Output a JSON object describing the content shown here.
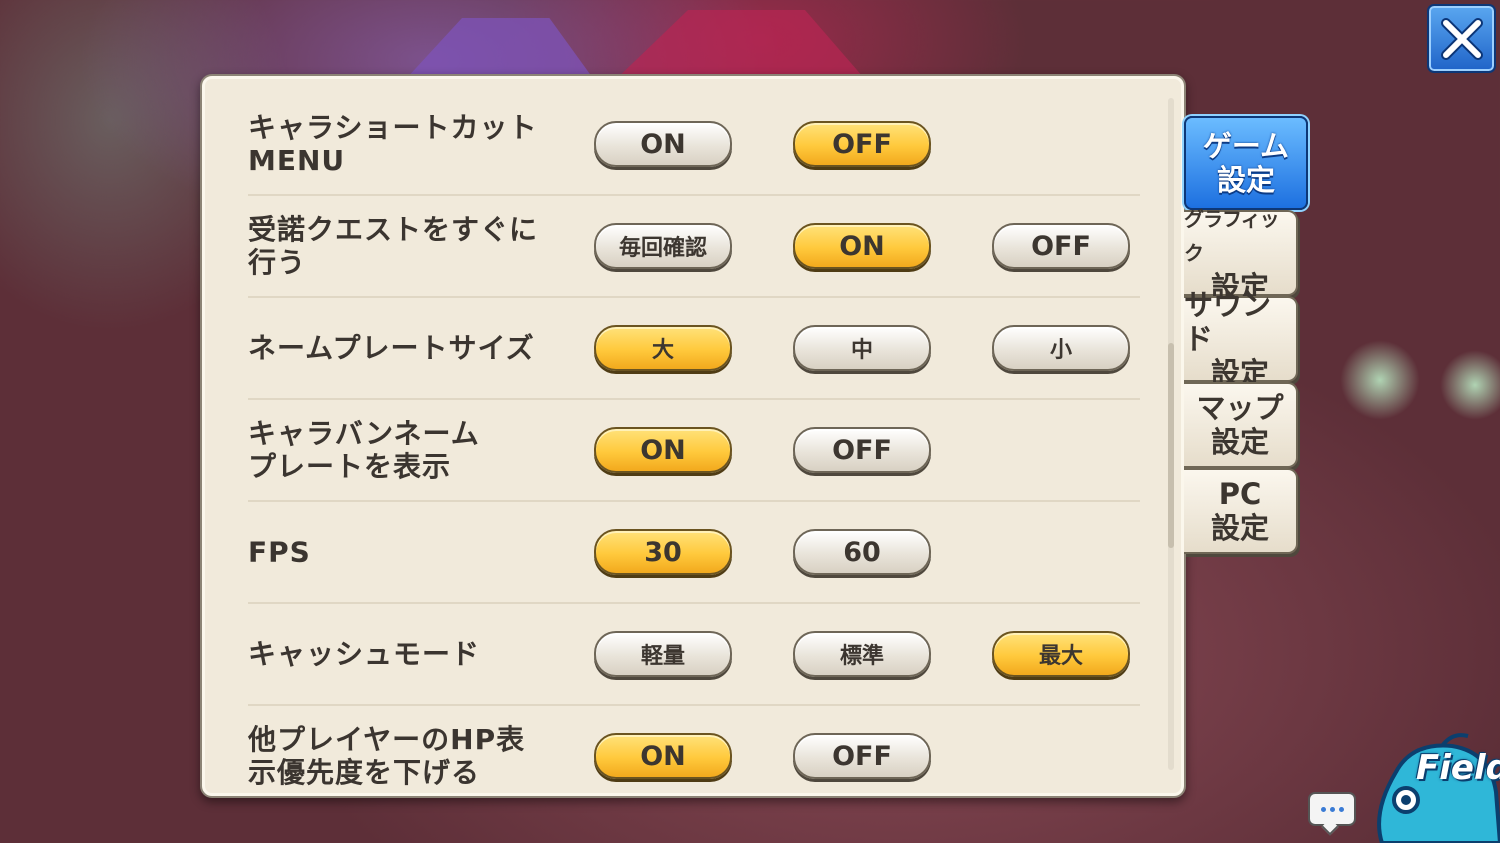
{
  "settings": [
    {
      "label": "キャラショートカット\nMENU",
      "options": [
        "ON",
        "OFF"
      ],
      "selected": 1
    },
    {
      "label": "受諾クエストをすぐに\n行う",
      "options": [
        "毎回確認",
        "ON",
        "OFF"
      ],
      "selected": 1
    },
    {
      "label": "ネームプレートサイズ",
      "options": [
        "大",
        "中",
        "小"
      ],
      "selected": 0
    },
    {
      "label": "キャラバンネーム\nプレートを表示",
      "options": [
        "ON",
        "OFF"
      ],
      "selected": 0
    },
    {
      "label": "FPS",
      "options": [
        "30",
        "60"
      ],
      "selected": 0
    },
    {
      "label": "キャッシュモード",
      "options": [
        "軽量",
        "標準",
        "最大"
      ],
      "selected": 2
    },
    {
      "label": "他プレイヤーのHP表\n示優先度を下げる",
      "options": [
        "ON",
        "OFF"
      ],
      "selected": 0
    }
  ],
  "tabs": [
    {
      "line1": "ゲーム",
      "line2": "設定",
      "active": true
    },
    {
      "line1": "グラフィック",
      "line2": "設定",
      "active": false
    },
    {
      "line1": "サウンド",
      "line2": "設定",
      "active": false
    },
    {
      "line1": "マップ",
      "line2": "設定",
      "active": false
    },
    {
      "line1": "PC",
      "line2": "設定",
      "active": false
    }
  ],
  "field_button": {
    "label": "Field"
  },
  "icons": {
    "close": "close-x-icon",
    "chat": "chat-bubble-icon"
  },
  "colors": {
    "selected": "#ffc93c",
    "tab_active": "#1d70e0",
    "panel": "#f1eadb"
  }
}
